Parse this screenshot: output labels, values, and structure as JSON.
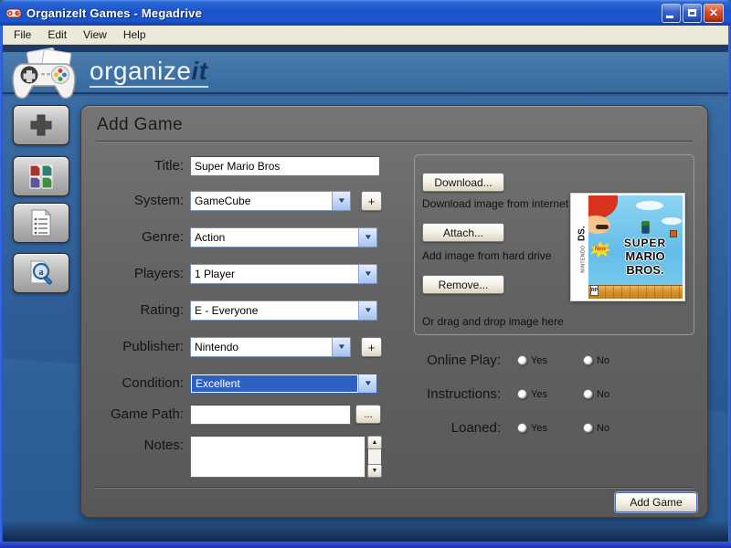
{
  "window": {
    "title": "OrganizeIt Games - Megadrive"
  },
  "menu": {
    "items": [
      "File",
      "Edit",
      "View",
      "Help"
    ]
  },
  "brand": {
    "logo_main": "organize",
    "logo_accent": "it"
  },
  "icons": {
    "close": "✕",
    "chevron_down": "▼",
    "arrow_up": "▲",
    "arrow_down": "▼"
  },
  "form": {
    "heading": "Add Game",
    "title": {
      "label": "Title:",
      "value": "Super Mario Bros"
    },
    "system": {
      "label": "System:",
      "value": "GameCube",
      "add_button": "+"
    },
    "genre": {
      "label": "Genre:",
      "value": "Action"
    },
    "players": {
      "label": "Players:",
      "value": "1 Player"
    },
    "rating": {
      "label": "Rating:",
      "value": "E - Everyone"
    },
    "publisher": {
      "label": "Publisher:",
      "value": "Nintendo",
      "add_button": "+"
    },
    "condition": {
      "label": "Condition:",
      "value": "Excellent"
    },
    "game_path": {
      "label": "Game Path:",
      "value": "",
      "browse_button": "..."
    },
    "notes": {
      "label": "Notes:",
      "value": ""
    },
    "submit_button": "Add Game"
  },
  "image_section": {
    "download_button": "Download...",
    "download_hint": "Download image from internet",
    "attach_button": "Attach...",
    "attach_hint": "Add image from hard drive",
    "remove_button": "Remove...",
    "drag_hint": "Or drag and drop image here",
    "box_art": {
      "platform_brand": "NINTENDO",
      "platform_model": "DS.",
      "badge": "New",
      "title_line1": "SUPER",
      "title_line2": "MARIO BROS.",
      "rating": "RP"
    }
  },
  "toggles": {
    "rows": [
      {
        "label": "Online Play:",
        "yes_label": "Yes",
        "no_label": "No"
      },
      {
        "label": "Instructions:",
        "yes_label": "Yes",
        "no_label": "No"
      },
      {
        "label": "Loaned:",
        "yes_label": "Yes",
        "no_label": "No"
      }
    ]
  },
  "colors": {
    "titlebar_blue": "#1d53c8",
    "header_blue": "#3f72a6",
    "panel_gray": "#646464",
    "selection_blue": "#2f5fc0",
    "close_red": "#d6502e"
  }
}
